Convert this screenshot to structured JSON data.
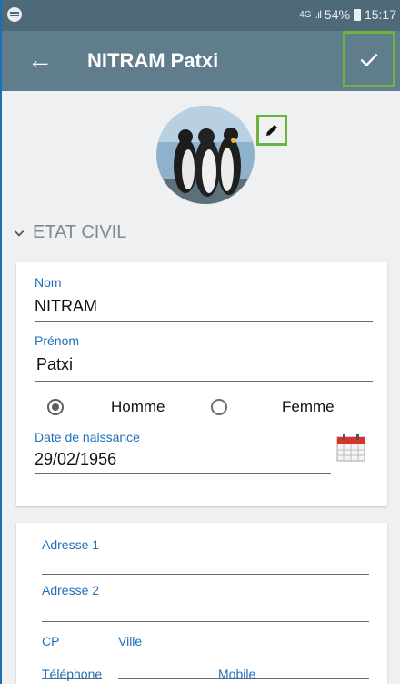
{
  "status": {
    "network": "4G",
    "battery_pct": "54%",
    "time": "15:17"
  },
  "toolbar": {
    "title": "NITRAM Patxi"
  },
  "section": {
    "etat_civil": "ETAT CIVIL"
  },
  "form": {
    "nom_label": "Nom",
    "nom_value": "NITRAM",
    "prenom_label": "Prénom",
    "prenom_value": "Patxi",
    "gender": {
      "homme": "Homme",
      "femme": "Femme",
      "selected": "Homme"
    },
    "dob_label": "Date de naissance",
    "dob_value": "29/02/1956",
    "adresse1_label": "Adresse 1",
    "adresse2_label": "Adresse 2",
    "cp_label": "CP",
    "ville_label": "Ville",
    "telephone_label": "Téléphone",
    "mobile_label": "Mobile"
  },
  "icons": {
    "status_left": "spotify-icon",
    "back": "arrow-back-icon",
    "confirm": "check-icon",
    "edit": "pencil-icon",
    "toggle": "chevron-down-icon",
    "calendar": "calendar-icon"
  },
  "colors": {
    "toolbar": "#607d8b",
    "statusbar": "#4e6a78",
    "label": "#1f6fb8",
    "highlight": "#6db33f",
    "calendar_red": "#d9322a"
  }
}
